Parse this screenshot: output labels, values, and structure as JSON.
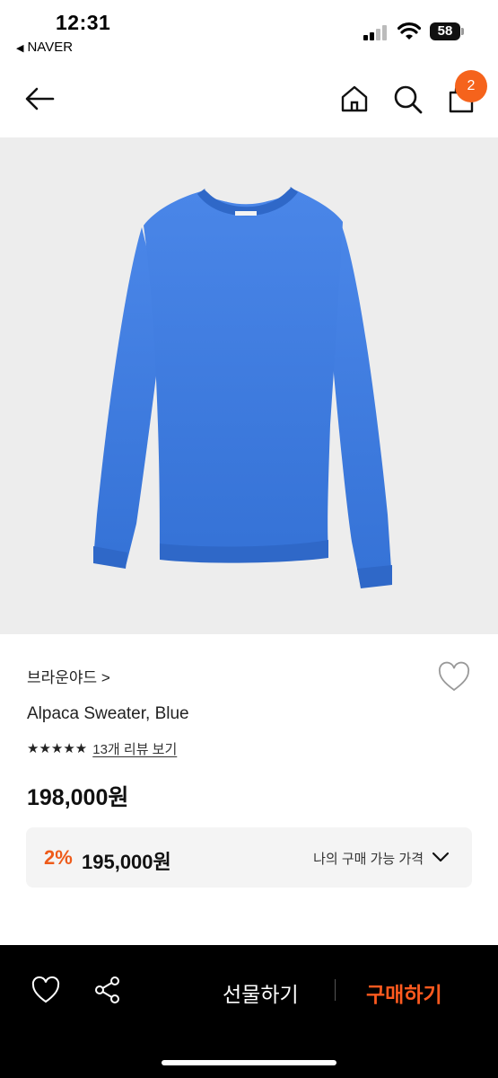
{
  "status_bar": {
    "time": "12:31",
    "back_app": "NAVER",
    "battery": "58"
  },
  "nav": {
    "cart_count": "2",
    "icons": [
      "back-arrow-icon",
      "home-icon",
      "search-icon",
      "shopping-bag-icon"
    ]
  },
  "product": {
    "brand": "브라운야드 >",
    "name": "Alpaca Sweater, Blue",
    "stars": "★★★★★",
    "review_link": "13개 리뷰 보기",
    "price": "198,000원",
    "image_color": "#3d7be0"
  },
  "my_price": {
    "discount": "2%",
    "price": "195,000원",
    "label": "나의 구매 가능 가격"
  },
  "bottom_bar": {
    "gift_label": "선물하기",
    "buy_label": "구매하기",
    "accent": "#ff5a1f"
  }
}
